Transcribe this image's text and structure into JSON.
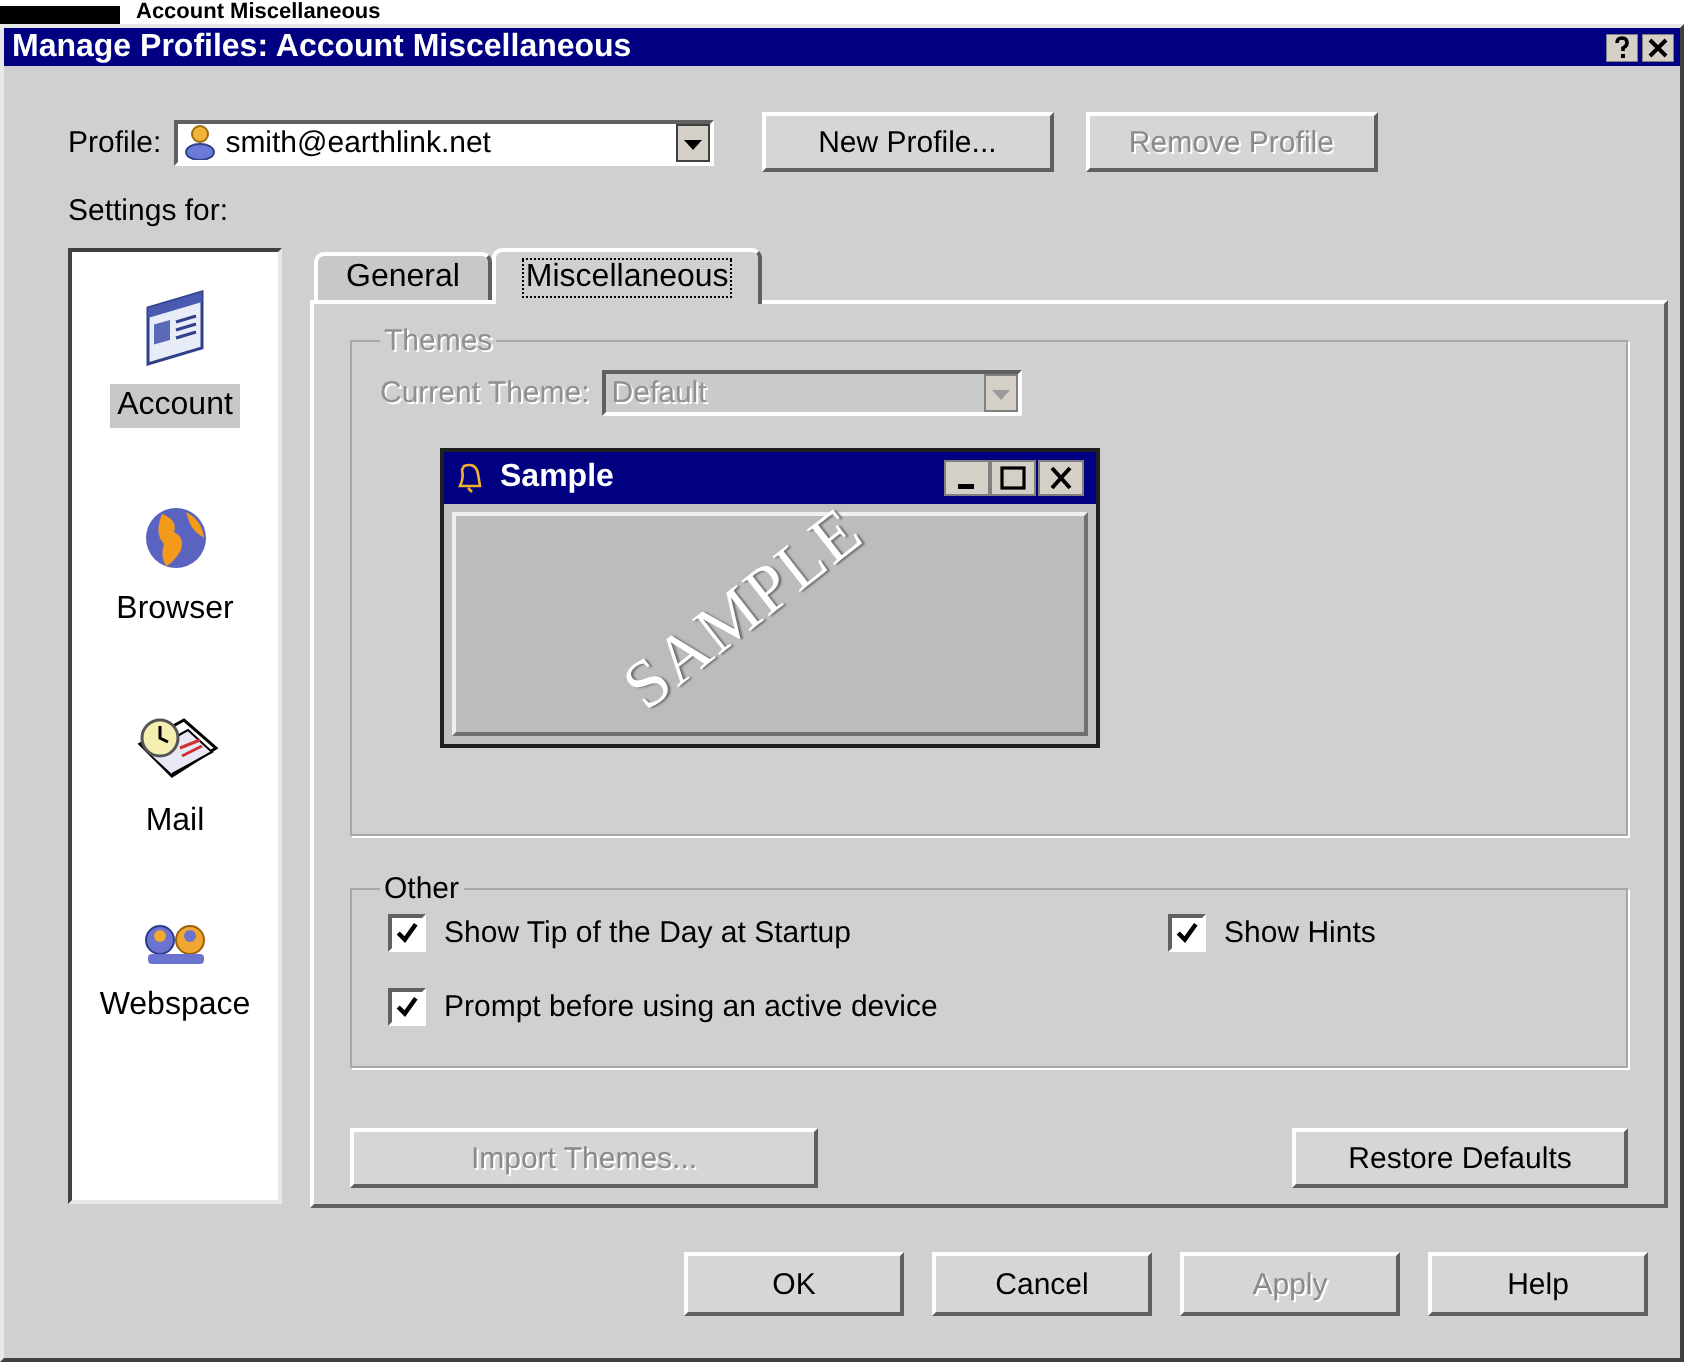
{
  "page_heading": "Account Miscellaneous",
  "window": {
    "title": "Manage Profiles: Account Miscellaneous"
  },
  "profile": {
    "label": "Profile:",
    "value": "smith@earthlink.net"
  },
  "profile_buttons": [
    {
      "label": "New Profile...",
      "disabled": false
    },
    {
      "label": "Remove Profile",
      "disabled": true
    }
  ],
  "settings_label": "Settings for:",
  "sidebar": {
    "items": [
      {
        "label": "Account",
        "kind": "account",
        "selected": true
      },
      {
        "label": "Browser",
        "kind": "browser",
        "selected": false
      },
      {
        "label": "Mail",
        "kind": "mail",
        "selected": false
      },
      {
        "label": "Webspace",
        "kind": "webspace",
        "selected": false
      }
    ]
  },
  "tabs": [
    {
      "label": "General",
      "selected": false
    },
    {
      "label": "Miscellaneous",
      "selected": true
    }
  ],
  "themes": {
    "title": "Themes",
    "disabled": true,
    "current_theme_label": "Current Theme:",
    "current_theme": "Default",
    "preview": {
      "title": "Sample",
      "overlay_text": "SAMPLE"
    }
  },
  "other": {
    "title": "Other",
    "options": [
      {
        "label": "Show Tip of the Day at Startup",
        "checked": true
      },
      {
        "label": "Show Hints",
        "checked": true
      },
      {
        "label": "Prompt before using an active device",
        "checked": true
      }
    ]
  },
  "panel_buttons": [
    {
      "label": "Import Themes...",
      "disabled": true
    },
    {
      "label": "Restore Defaults",
      "disabled": false
    }
  ],
  "dialog_buttons": [
    {
      "label": "OK",
      "disabled": false
    },
    {
      "label": "Cancel",
      "disabled": false
    },
    {
      "label": "Apply",
      "disabled": true
    },
    {
      "label": "Help",
      "disabled": false
    }
  ]
}
